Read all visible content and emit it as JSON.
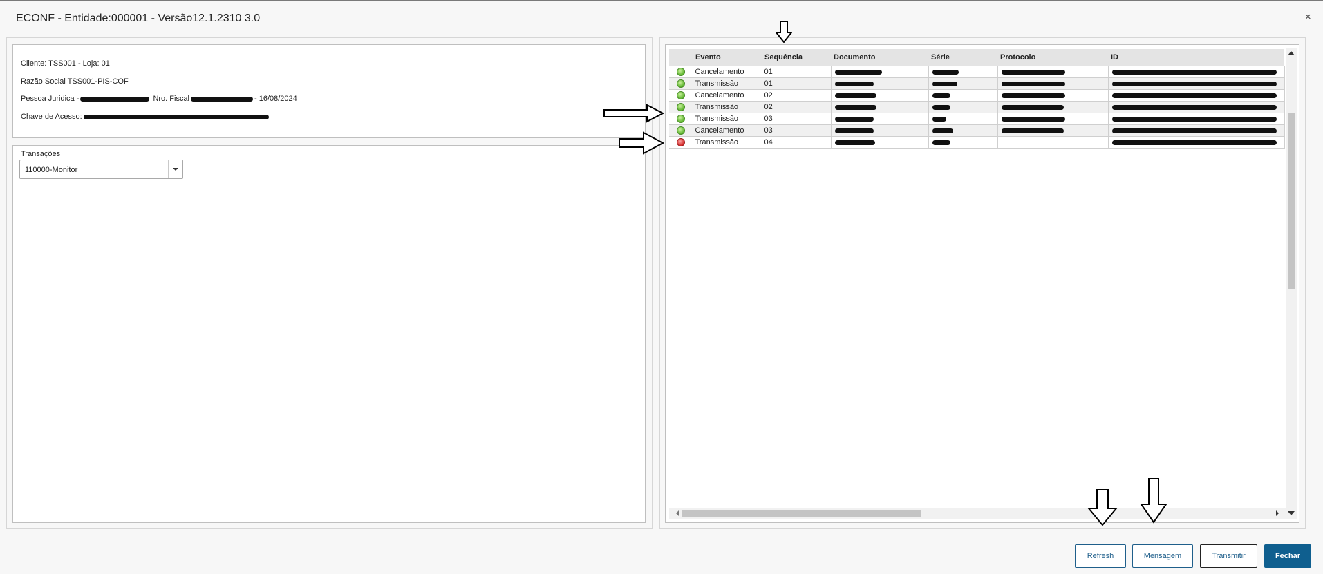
{
  "window": {
    "title": "ECONF - Entidade:000001 - Versão12.1.2310  3.0",
    "close_icon": "×"
  },
  "info": {
    "cliente": "Cliente: TSS001 - Loja: 01",
    "razao": "Razão Social TSS001-PIS-COF",
    "pessoa_prefix": "Pessoa Juridica -",
    "nro_fiscal": "Nro. Fiscal",
    "date": "- 16/08/2024",
    "chave": "Chave de Acesso:"
  },
  "transacoes": {
    "label": "Transações",
    "selected": "110000-Monitor"
  },
  "grid": {
    "columns": [
      "",
      "Evento",
      "Sequência",
      "Documento",
      "Série",
      "Protocolo",
      "ID"
    ],
    "rows": [
      {
        "status": "green",
        "evento": "Cancelamento",
        "seq": "01"
      },
      {
        "status": "green",
        "evento": "Transmissão",
        "seq": "01"
      },
      {
        "status": "green",
        "evento": "Cancelamento",
        "seq": "02"
      },
      {
        "status": "green",
        "evento": "Transmissão",
        "seq": "02"
      },
      {
        "status": "green",
        "evento": "Transmissão",
        "seq": "03"
      },
      {
        "status": "green",
        "evento": "Cancelamento",
        "seq": "03"
      },
      {
        "status": "red",
        "evento": "Transmissão",
        "seq": "04"
      }
    ]
  },
  "buttons": {
    "refresh": "Refresh",
    "mensagem": "Mensagem",
    "transmitir": "Transmitir",
    "fechar": "Fechar"
  },
  "colors": {
    "primary": "#0f5f8f",
    "status_ok": "#5db52e",
    "status_error": "#d42a2a"
  }
}
